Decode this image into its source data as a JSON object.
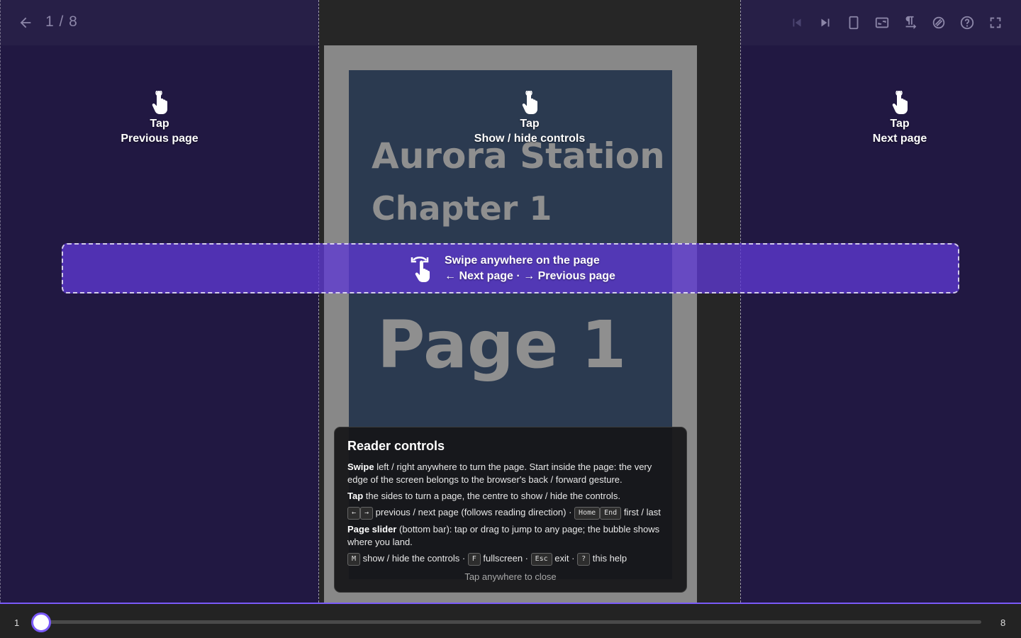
{
  "header": {
    "page_count": "1 / 8"
  },
  "toolbar": [
    {
      "name": "first-page-button",
      "icon": "skip-first-icon",
      "disabled": true
    },
    {
      "name": "last-page-button",
      "icon": "skip-last-icon",
      "disabled": false
    },
    {
      "name": "single-page-button",
      "icon": "single-page-icon",
      "disabled": false
    },
    {
      "name": "fit-mode-button",
      "icon": "fit-screen-icon",
      "disabled": false
    },
    {
      "name": "reading-direction-button",
      "icon": "text-direction-icon",
      "disabled": false
    },
    {
      "name": "theme-button",
      "icon": "palette-icon",
      "disabled": false
    },
    {
      "name": "help-button",
      "icon": "help-icon",
      "disabled": false
    },
    {
      "name": "fullscreen-button",
      "icon": "fullscreen-icon",
      "disabled": false
    }
  ],
  "page": {
    "title": "Aurora Station",
    "chapter": "Chapter 1",
    "number": "Page 1"
  },
  "hints": {
    "left": {
      "action": "Tap",
      "label": "Previous page"
    },
    "center": {
      "action": "Tap",
      "label": "Show / hide controls"
    },
    "right": {
      "action": "Tap",
      "label": "Next page"
    }
  },
  "swipe": {
    "line1": "Swipe anywhere on the page",
    "line2": "← Next page  ·  → Previous page"
  },
  "help": {
    "title": "Reader controls",
    "swipe_b": "Swipe",
    "swipe_t": " left / right anywhere to turn the page. Start inside the page: the very edge of the screen belongs to the browser's back / forward gesture.",
    "tap_b": "Tap",
    "tap_t": " the sides to turn a page, the centre to show / hide the controls.",
    "k_left": "←",
    "k_right": "→",
    "arrows_t": " previous / next page (follows reading direction) · ",
    "k_home": "Home",
    "k_end": "End",
    "firstlast_t": " first / last",
    "slider_b": "Page slider",
    "slider_t": " (bottom bar): tap or drag to jump to any page; the bubble shows where you land.",
    "k_m": "M",
    "m_t": " show / hide the controls · ",
    "k_f": "F",
    "f_t": " fullscreen · ",
    "k_esc": "Esc",
    "esc_t": " exit · ",
    "k_q": "?",
    "q_t": " this help",
    "close_hint": "Tap anywhere to close"
  },
  "slider": {
    "min_label": "1",
    "max_label": "8",
    "min": 1,
    "max": 8,
    "value": 1,
    "accent": "#7a5af8"
  }
}
